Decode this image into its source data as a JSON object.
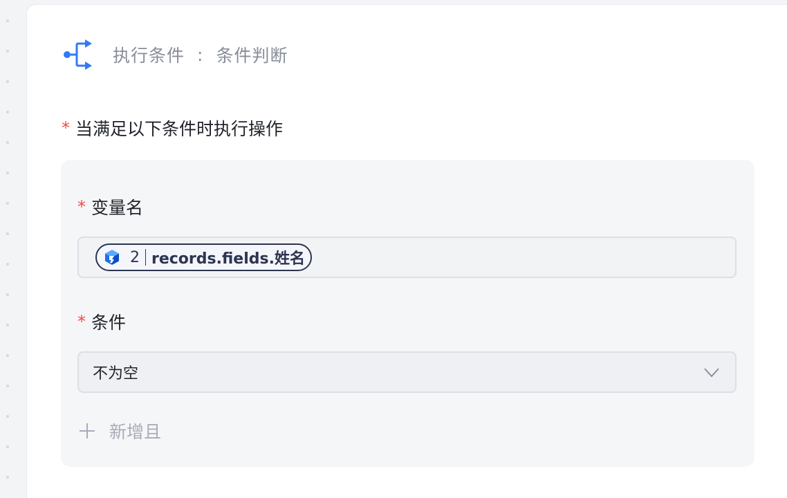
{
  "header": {
    "icon": "branch-flow-icon",
    "title": "执行条件",
    "separator": ":",
    "subtitle": "条件判断"
  },
  "section": {
    "required_mark": "*",
    "label": "当满足以下条件时执行操作"
  },
  "condition": {
    "variable": {
      "required_mark": "*",
      "label": "变量名",
      "tag_icon": "cube-icon",
      "tag_step": "2",
      "tag_path": "records.fields.姓名"
    },
    "operator": {
      "required_mark": "*",
      "label": "条件",
      "selected": "不为空",
      "arrow_icon": "chevron-down-icon"
    },
    "add_and_label": "新增且"
  },
  "colors": {
    "accent": "#2f7bf5",
    "required": "#f54a45",
    "tag_border": "#2c3550",
    "muted_text": "#a6acb8"
  }
}
